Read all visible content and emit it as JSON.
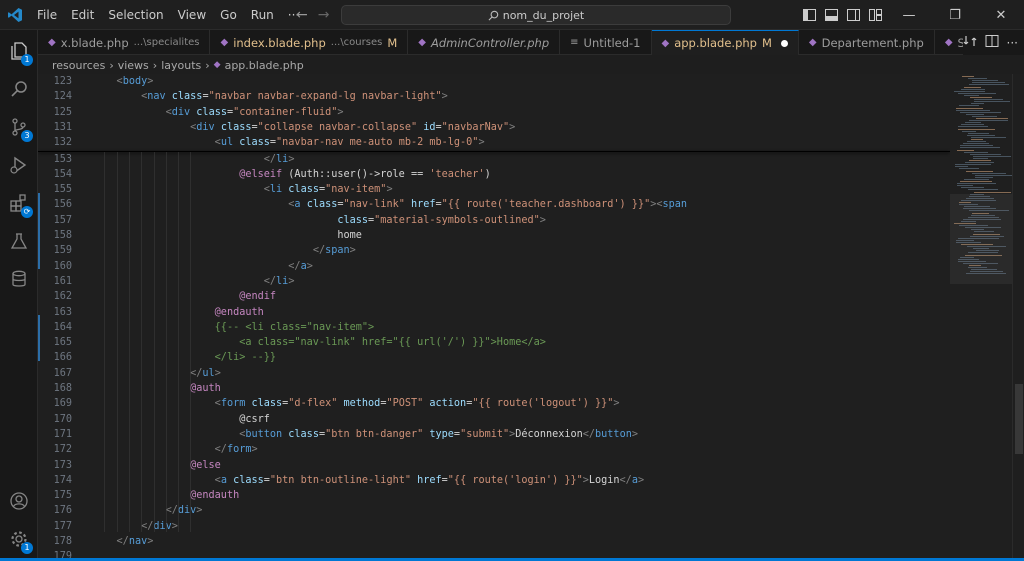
{
  "menu": [
    "File",
    "Edit",
    "Selection",
    "View",
    "Go",
    "Run",
    "···"
  ],
  "search": {
    "text": "nom_du_projet"
  },
  "window_controls": {
    "minimize": "—",
    "restore": "❐",
    "close": "✕"
  },
  "activity_badges": {
    "explorer": "1",
    "scm": "3",
    "settings": "1"
  },
  "tabs": [
    {
      "name": "x.blade.php",
      "path": "...\\specialites",
      "modified": "",
      "active": false
    },
    {
      "name": "index.blade.php",
      "path": "...\\courses",
      "modified": "M",
      "active": false
    },
    {
      "name": "AdminController.php",
      "path": "",
      "modified": "",
      "active": false
    },
    {
      "name": "Untitled-1",
      "path": "",
      "modified": "",
      "active": false
    },
    {
      "name": "app.blade.php",
      "path": "",
      "modified": "M",
      "active": true
    },
    {
      "name": "Departement.php",
      "path": "",
      "modified": "",
      "active": false
    },
    {
      "name": "Specialite.php",
      "path": "",
      "modified": "",
      "active": false
    }
  ],
  "breadcrumb": [
    "resources",
    "views",
    "layouts",
    "app.blade.php"
  ],
  "sticky_lines": [
    {
      "num": "123",
      "indent": 2,
      "segs": [
        [
          "t-punc",
          "<"
        ],
        [
          "t-tag",
          "body"
        ],
        [
          "t-punc",
          ">"
        ]
      ]
    },
    {
      "num": "124",
      "indent": 4,
      "segs": [
        [
          "t-punc",
          "<"
        ],
        [
          "t-tag",
          "nav "
        ],
        [
          "t-attr",
          "class"
        ],
        [
          "t-txt",
          "="
        ],
        [
          "t-str",
          "\"navbar navbar-expand-lg navbar-light\""
        ],
        [
          "t-punc",
          ">"
        ]
      ]
    },
    {
      "num": "125",
      "indent": 6,
      "segs": [
        [
          "t-punc",
          "<"
        ],
        [
          "t-tag",
          "div "
        ],
        [
          "t-attr",
          "class"
        ],
        [
          "t-txt",
          "="
        ],
        [
          "t-str",
          "\"container-fluid\""
        ],
        [
          "t-punc",
          ">"
        ]
      ]
    },
    {
      "num": "131",
      "indent": 8,
      "segs": [
        [
          "t-punc",
          "<"
        ],
        [
          "t-tag",
          "div "
        ],
        [
          "t-attr",
          "class"
        ],
        [
          "t-txt",
          "="
        ],
        [
          "t-str",
          "\"collapse navbar-collapse\" "
        ],
        [
          "t-attr",
          "id"
        ],
        [
          "t-txt",
          "="
        ],
        [
          "t-str",
          "\"navbarNav\""
        ],
        [
          "t-punc",
          ">"
        ]
      ]
    },
    {
      "num": "132",
      "indent": 10,
      "segs": [
        [
          "t-punc",
          "<"
        ],
        [
          "t-tag",
          "ul "
        ],
        [
          "t-attr",
          "class"
        ],
        [
          "t-txt",
          "="
        ],
        [
          "t-str",
          "\"navbar-nav me-auto mb-2 mb-lg-0\""
        ],
        [
          "t-punc",
          ">"
        ]
      ]
    }
  ],
  "lines": [
    {
      "num": "153",
      "indent": 14,
      "segs": [
        [
          "t-punc",
          "</"
        ],
        [
          "t-tag",
          "li"
        ],
        [
          "t-punc",
          ">"
        ]
      ]
    },
    {
      "num": "154",
      "indent": 12,
      "segs": [
        [
          "t-blade",
          "@elseif "
        ],
        [
          "t-txt",
          "(Auth::user()->role == "
        ],
        [
          "t-str",
          "'teacher'"
        ],
        [
          "t-txt",
          ")"
        ]
      ]
    },
    {
      "num": "155",
      "indent": 14,
      "segs": [
        [
          "t-punc",
          "<"
        ],
        [
          "t-tag",
          "li "
        ],
        [
          "t-attr",
          "class"
        ],
        [
          "t-txt",
          "="
        ],
        [
          "t-str",
          "\"nav-item\""
        ],
        [
          "t-punc",
          ">"
        ]
      ]
    },
    {
      "num": "156",
      "indent": 16,
      "segs": [
        [
          "t-punc",
          "<"
        ],
        [
          "t-tag",
          "a "
        ],
        [
          "t-attr",
          "class"
        ],
        [
          "t-txt",
          "="
        ],
        [
          "t-str",
          "\"nav-link\" "
        ],
        [
          "t-attr",
          "href"
        ],
        [
          "t-txt",
          "="
        ],
        [
          "t-str",
          "\"{{ route('teacher.dashboard') }}\""
        ],
        [
          "t-punc",
          ">"
        ],
        [
          "t-punc",
          "<"
        ],
        [
          "t-tag",
          "span"
        ]
      ]
    },
    {
      "num": "157",
      "indent": 20,
      "segs": [
        [
          "t-attr",
          "class"
        ],
        [
          "t-txt",
          "="
        ],
        [
          "t-str",
          "\"material-symbols-outlined\""
        ],
        [
          "t-punc",
          ">"
        ]
      ]
    },
    {
      "num": "158",
      "indent": 20,
      "segs": [
        [
          "t-txt",
          "home"
        ]
      ]
    },
    {
      "num": "159",
      "indent": 18,
      "segs": [
        [
          "t-punc",
          "</"
        ],
        [
          "t-tag",
          "span"
        ],
        [
          "t-punc",
          ">"
        ]
      ]
    },
    {
      "num": "160",
      "indent": 16,
      "segs": [
        [
          "t-punc",
          "</"
        ],
        [
          "t-tag",
          "a"
        ],
        [
          "t-punc",
          ">"
        ]
      ]
    },
    {
      "num": "161",
      "indent": 14,
      "segs": [
        [
          "t-punc",
          "</"
        ],
        [
          "t-tag",
          "li"
        ],
        [
          "t-punc",
          ">"
        ]
      ]
    },
    {
      "num": "162",
      "indent": 12,
      "segs": [
        [
          "t-blade",
          "@endif"
        ]
      ]
    },
    {
      "num": "163",
      "indent": 10,
      "segs": [
        [
          "t-blade",
          "@endauth"
        ]
      ]
    },
    {
      "num": "164",
      "indent": 10,
      "segs": [
        [
          "t-cmt",
          "{{-- <li class=\"nav-item\">"
        ]
      ]
    },
    {
      "num": "165",
      "indent": 12,
      "segs": [
        [
          "t-cmt",
          "<a class=\"nav-link\" href=\"{{ url('/') }}\">Home</a>"
        ]
      ]
    },
    {
      "num": "166",
      "indent": 10,
      "segs": [
        [
          "t-cmt",
          "</li> --}}"
        ]
      ]
    },
    {
      "num": "167",
      "indent": 8,
      "segs": [
        [
          "t-punc",
          "</"
        ],
        [
          "t-tag",
          "ul"
        ],
        [
          "t-punc",
          ">"
        ]
      ]
    },
    {
      "num": "168",
      "indent": 8,
      "segs": [
        [
          "t-blade",
          "@auth"
        ]
      ]
    },
    {
      "num": "169",
      "indent": 10,
      "segs": [
        [
          "t-punc",
          "<"
        ],
        [
          "t-tag",
          "form "
        ],
        [
          "t-attr",
          "class"
        ],
        [
          "t-txt",
          "="
        ],
        [
          "t-str",
          "\"d-flex\" "
        ],
        [
          "t-attr",
          "method"
        ],
        [
          "t-txt",
          "="
        ],
        [
          "t-str",
          "\"POST\" "
        ],
        [
          "t-attr",
          "action"
        ],
        [
          "t-txt",
          "="
        ],
        [
          "t-str",
          "\"{{ route('logout') }}\""
        ],
        [
          "t-punc",
          ">"
        ]
      ]
    },
    {
      "num": "170",
      "indent": 12,
      "segs": [
        [
          "t-txt",
          "@csrf"
        ]
      ]
    },
    {
      "num": "171",
      "indent": 12,
      "segs": [
        [
          "t-punc",
          "<"
        ],
        [
          "t-tag",
          "button "
        ],
        [
          "t-attr",
          "class"
        ],
        [
          "t-txt",
          "="
        ],
        [
          "t-str",
          "\"btn btn-danger\" "
        ],
        [
          "t-attr",
          "type"
        ],
        [
          "t-txt",
          "="
        ],
        [
          "t-str",
          "\"submit\""
        ],
        [
          "t-punc",
          ">"
        ],
        [
          "t-txt",
          "Déconnexion"
        ],
        [
          "t-punc",
          "</"
        ],
        [
          "t-tag",
          "button"
        ],
        [
          "t-punc",
          ">"
        ]
      ]
    },
    {
      "num": "172",
      "indent": 10,
      "segs": [
        [
          "t-punc",
          "</"
        ],
        [
          "t-tag",
          "form"
        ],
        [
          "t-punc",
          ">"
        ]
      ]
    },
    {
      "num": "173",
      "indent": 8,
      "segs": [
        [
          "t-blade",
          "@else"
        ]
      ]
    },
    {
      "num": "174",
      "indent": 10,
      "segs": [
        [
          "t-punc",
          "<"
        ],
        [
          "t-tag",
          "a "
        ],
        [
          "t-attr",
          "class"
        ],
        [
          "t-txt",
          "="
        ],
        [
          "t-str",
          "\"btn btn-outline-light\" "
        ],
        [
          "t-attr",
          "href"
        ],
        [
          "t-txt",
          "="
        ],
        [
          "t-str",
          "\"{{ route('login') }}\""
        ],
        [
          "t-punc",
          ">"
        ],
        [
          "t-txt",
          "Login"
        ],
        [
          "t-punc",
          "</"
        ],
        [
          "t-tag",
          "a"
        ],
        [
          "t-punc",
          ">"
        ]
      ]
    },
    {
      "num": "175",
      "indent": 8,
      "segs": [
        [
          "t-blade",
          "@endauth"
        ]
      ]
    },
    {
      "num": "176",
      "indent": 6,
      "segs": [
        [
          "t-punc",
          "</"
        ],
        [
          "t-tag",
          "div"
        ],
        [
          "t-punc",
          ">"
        ]
      ]
    },
    {
      "num": "177",
      "indent": 4,
      "segs": [
        [
          "t-punc",
          "</"
        ],
        [
          "t-tag",
          "div"
        ],
        [
          "t-punc",
          ">"
        ]
      ]
    },
    {
      "num": "178",
      "indent": 2,
      "segs": [
        [
          "t-punc",
          "</"
        ],
        [
          "t-tag",
          "nav"
        ],
        [
          "t-punc",
          ">"
        ]
      ]
    },
    {
      "num": "179",
      "indent": 0,
      "segs": []
    }
  ]
}
